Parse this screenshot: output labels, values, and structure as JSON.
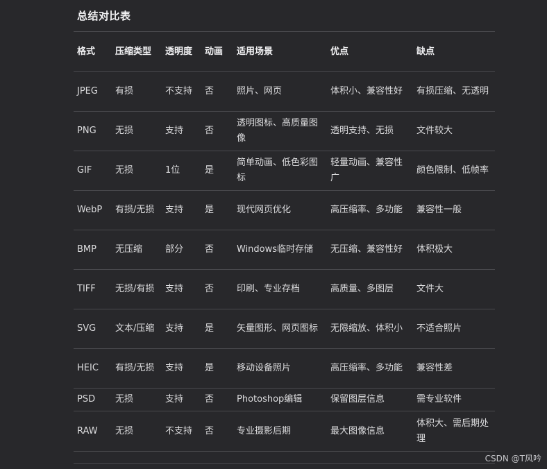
{
  "heading": "总结对比表",
  "table": {
    "headers": [
      "格式",
      "压缩类型",
      "透明度",
      "动画",
      "适用场景",
      "优点",
      "缺点"
    ],
    "rows": [
      [
        "JPEG",
        "有损",
        "不支持",
        "否",
        "照片、网页",
        "体积小、兼容性好",
        "有损压缩、无透明"
      ],
      [
        "PNG",
        "无损",
        "支持",
        "否",
        "透明图标、高质量图像",
        "透明支持、无损",
        "文件较大"
      ],
      [
        "GIF",
        "无损",
        "1位",
        "是",
        "简单动画、低色彩图标",
        "轻量动画、兼容性广",
        "颜色限制、低帧率"
      ],
      [
        "WebP",
        "有损/无损",
        "支持",
        "是",
        "现代网页优化",
        "高压缩率、多功能",
        "兼容性一般"
      ],
      [
        "BMP",
        "无压缩",
        "部分",
        "否",
        "Windows临时存储",
        "无压缩、兼容性好",
        "体积极大"
      ],
      [
        "TIFF",
        "无损/有损",
        "支持",
        "否",
        "印刷、专业存档",
        "高质量、多图层",
        "文件大"
      ],
      [
        "SVG",
        "文本/压缩",
        "支持",
        "是",
        "矢量图形、网页图标",
        "无限缩放、体积小",
        "不适合照片"
      ],
      [
        "HEIC",
        "有损/无损",
        "支持",
        "是",
        "移动设备照片",
        "高压缩率、多功能",
        "兼容性差"
      ],
      [
        "PSD",
        "无损",
        "支持",
        "否",
        "Photoshop编辑",
        "保留图层信息",
        "需专业软件"
      ],
      [
        "RAW",
        "无损",
        "不支持",
        "否",
        "专业摄影后期",
        "最大图像信息",
        "体积大、需后期处理"
      ]
    ]
  },
  "watermark": "CSDN @T风吟"
}
